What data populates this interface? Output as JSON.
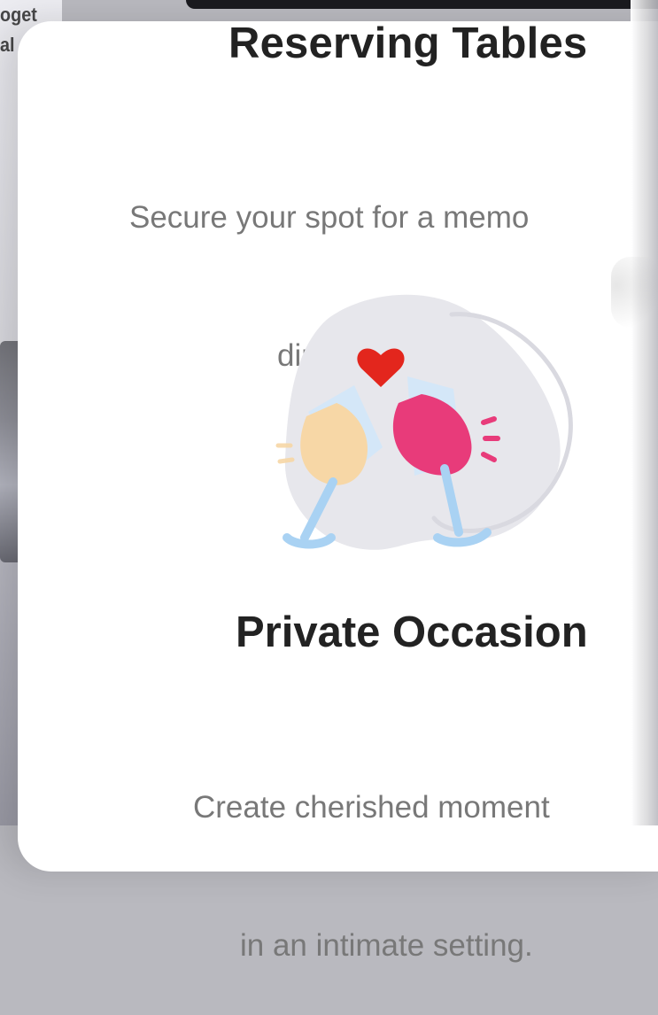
{
  "background": {
    "left_peek_lines": [
      "oget",
      "al"
    ]
  },
  "cards": [
    {
      "title": "Reserving Tables",
      "subtitle_lines": [
        "Secure your spot for a memo",
        "dining adventure."
      ]
    },
    {
      "title": "Private Occasion",
      "subtitle_lines": [
        "Create cherished moment",
        "in an intimate setting."
      ]
    }
  ],
  "illustration": {
    "icons": [
      "heart-icon",
      "toasting-glasses-icon",
      "sparkle-lines-icon"
    ],
    "colors": {
      "blob": "#e7e7ec",
      "outline": "#d9d9e0",
      "heart": "#e3261d",
      "glass_stem": "#a9d2f3",
      "left_drink": "#f7d7a6",
      "right_drink": "#e83b7a",
      "sparkles": "#e83b7a"
    }
  }
}
